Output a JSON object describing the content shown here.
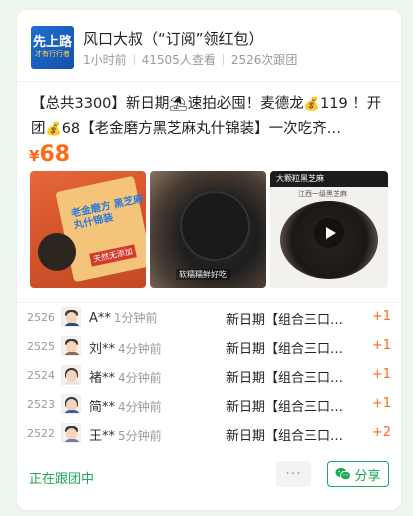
{
  "header": {
    "avatar_line1": "先上路",
    "avatar_line2": "才有行行者",
    "title": "风口大叔（“订阅”领红包）",
    "time": "1小时前",
    "views": "41505人查看",
    "groups": "2526次跟团"
  },
  "post": {
    "desc_part1": "【总共3300】新日期⛱速拍必囤！麦德龙",
    "desc_part2": "119 ！开团",
    "desc_part3": "68【老金磨方黑芝麻丸什锦装】一次吃齐…",
    "price_symbol": "¥",
    "price": "68"
  },
  "images": {
    "img1_text": "老金磨方 黑芝麻丸什锦装",
    "img1_tag": "天然无添加",
    "img2_caption": "软糯糯鲜好吃",
    "img3_top": "大颗粒黑芝麻",
    "img3_sub": "江西一级黑芝麻"
  },
  "orders": [
    {
      "num": "2526",
      "name": "A**",
      "time": "1分钟前",
      "item": "新日期【组合三口…",
      "qty": "+1"
    },
    {
      "num": "2525",
      "name": "刘**",
      "time": "4分钟前",
      "item": "新日期【组合三口…",
      "qty": "+1"
    },
    {
      "num": "2524",
      "name": "褚**",
      "time": "4分钟前",
      "item": "新日期【组合三口…",
      "qty": "+1"
    },
    {
      "num": "2523",
      "name": "简**",
      "time": "4分钟前",
      "item": "新日期【组合三口…",
      "qty": "+1"
    },
    {
      "num": "2522",
      "name": "王**",
      "time": "5分钟前",
      "item": "新日期【组合三口…",
      "qty": "+2"
    }
  ],
  "footer": {
    "status": "正在跟团中",
    "more": "···",
    "share": "分享"
  },
  "colors": {
    "accent_orange": "#ff6a1a",
    "accent_green": "#1aa85a",
    "background": "#eef7ef"
  }
}
